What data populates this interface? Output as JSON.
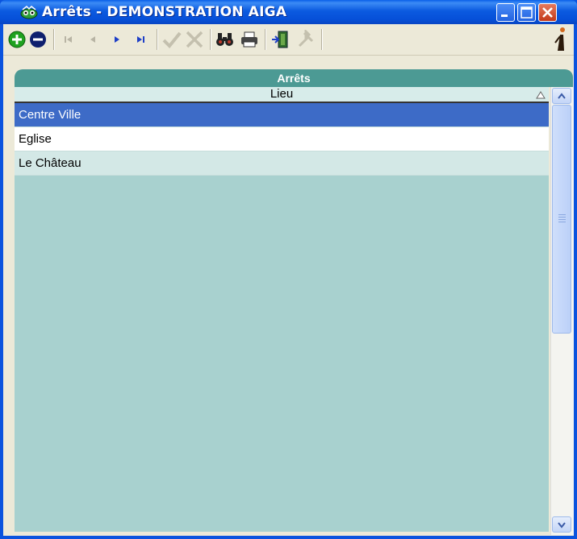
{
  "window": {
    "title": "Arrêts - DEMONSTRATION AIGA",
    "controls": [
      "minimize",
      "maximize",
      "close"
    ]
  },
  "toolbar": {
    "buttons": [
      {
        "name": "add",
        "icon": "plus-circle-icon",
        "color": "#1FA21F"
      },
      {
        "name": "delete",
        "icon": "minus-circle-icon",
        "color": "#0E1F6E"
      },
      {
        "name": "first-record",
        "icon": "first-record-icon",
        "enabled": false
      },
      {
        "name": "previous-record",
        "icon": "previous-record-icon",
        "enabled": false
      },
      {
        "name": "next-record",
        "icon": "next-record-icon",
        "color": "#1E3FC7"
      },
      {
        "name": "last-record",
        "icon": "last-record-icon",
        "color": "#1E3FC7"
      },
      {
        "name": "validate",
        "icon": "check-icon",
        "enabled": false
      },
      {
        "name": "cancel",
        "icon": "cross-icon",
        "enabled": false
      },
      {
        "name": "search",
        "icon": "binoculars-icon"
      },
      {
        "name": "print",
        "icon": "printer-icon"
      },
      {
        "name": "exit",
        "icon": "exit-door-icon"
      },
      {
        "name": "tools",
        "icon": "tools-icon",
        "enabled": false
      },
      {
        "name": "help",
        "icon": "pointer-figure-icon"
      }
    ]
  },
  "panel": {
    "title": "Arrêts",
    "column_header": "Lieu",
    "sort": "ascending",
    "rows": [
      {
        "label": "Centre Ville",
        "selected": true
      },
      {
        "label": "Eglise",
        "selected": false
      },
      {
        "label": "Le Château",
        "selected": false
      }
    ]
  },
  "colors": {
    "titlebar": "#0A53DE",
    "panel_header": "#4C9A94",
    "grid_background": "#A8D1CF",
    "selected_row": "#3D6BC7"
  }
}
